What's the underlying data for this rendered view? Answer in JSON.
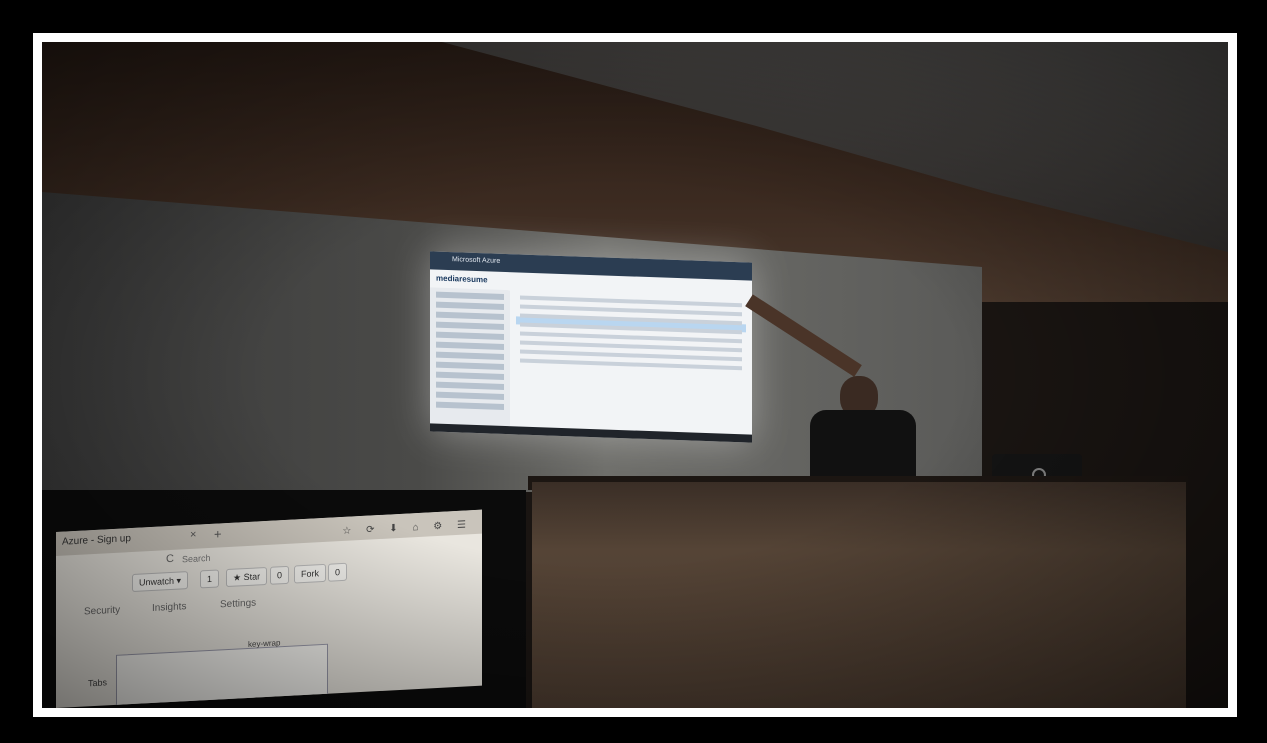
{
  "projection": {
    "portal_title": "Microsoft Azure",
    "page_title": "mediaresume"
  },
  "laptop_browser": {
    "tab_title": "Azure - Sign up",
    "tab_close": "×",
    "tab_new": "+",
    "reload": "C",
    "search_placeholder": "Search",
    "unwatch_label": "Unwatch ▾",
    "watch_count": "1",
    "star_label": "★ Star",
    "star_count": "0",
    "fork_label": "Fork",
    "fork_count": "0",
    "nav_security": "Security",
    "nav_insights": "Insights",
    "nav_settings": "Settings",
    "keyword": "key-wrap",
    "tabs_label": "Tabs",
    "toolbar_icons": "☆ ⟳ ⬇ ⌂ ⚙ ☰"
  }
}
